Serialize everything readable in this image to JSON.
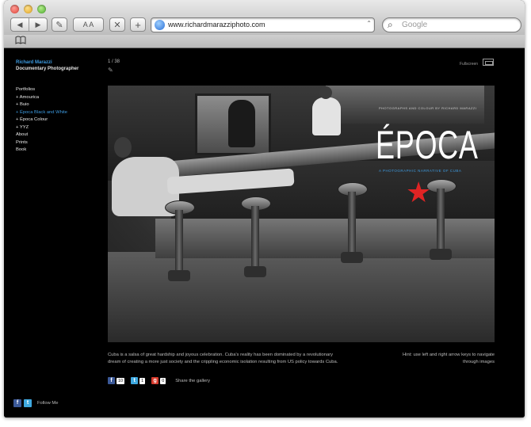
{
  "browser": {
    "url": "www.richardmarazziphoto.com",
    "search_placeholder": "Google",
    "back_glyph": "◀",
    "forward_glyph": "▶",
    "text_size_glyph": "A A",
    "stop_glyph": "✕",
    "add_glyph": "+",
    "bookmarks_glyph": "📖"
  },
  "site": {
    "name": "Richard Marazzi",
    "subtitle": "Documentary Photographer",
    "accent_color": "#3d9be0"
  },
  "nav": {
    "items": [
      {
        "label": "Portfolios",
        "active": false
      },
      {
        "label": "+ Amourica",
        "active": false
      },
      {
        "label": "+ Buio",
        "active": false
      },
      {
        "label": "+ Época Black and White",
        "active": true
      },
      {
        "label": "+ Época Colour",
        "active": false
      },
      {
        "label": "+ YYZ",
        "active": false
      },
      {
        "label": "About",
        "active": false
      },
      {
        "label": "Prints",
        "active": false
      },
      {
        "label": "Book",
        "active": false
      }
    ]
  },
  "gallery": {
    "counter": "1 / 38",
    "fullscreen_label": "Fullscreen"
  },
  "photo": {
    "title": "ÉPOCA",
    "credit": "PHOTOGRAPHS AND COLOUR BY RICHARD MARAZZI",
    "tagline": "A PHOTOGRAPHIC NARRATIVE OF CUBA",
    "star_color": "#e02424"
  },
  "caption": "Cuba is a salsa of great hardship and joyous celebration. Cuba's reality has been dominated by a revolutionary dream of creating a more just society and the crippling economic isolation resulting from US policy towards Cuba.",
  "hint": "Hint: use left and right arrow keys to navigate through images",
  "share": {
    "facebook_count": "10",
    "twitter_count": "1",
    "google_count": "0",
    "label": "Share the gallery"
  },
  "footer": {
    "follow_label": "Follow Me"
  }
}
